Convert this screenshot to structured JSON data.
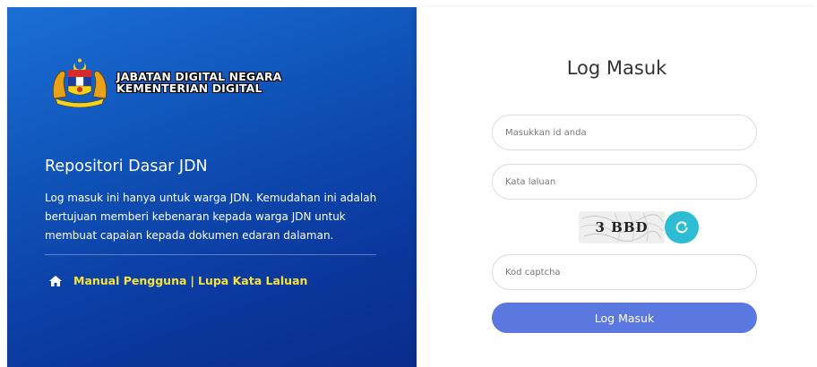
{
  "left": {
    "agency_line1": "JABATAN DIGITAL NEGARA",
    "agency_line2": "KEMENTERIAN DIGITAL",
    "title": "Repositori Dasar JDN",
    "description": "Log masuk ini hanya untuk warga JDN. Kemudahan ini adalah bertujuan memberi kebenaran kepada warga JDN untuk membuat capaian kepada dokumen edaran dalaman.",
    "links": {
      "manual": "Manual Pengguna",
      "separator": "|",
      "forgot": "Lupa Kata Laluan",
      "color": "#f7e23a"
    }
  },
  "form": {
    "title": "Log Masuk",
    "id_placeholder": "Masukkan id anda",
    "password_placeholder": "Kata laluan",
    "captcha_text": "3 BBD",
    "captcha_placeholder": "Kod captcha",
    "submit_label": "Log Masuk",
    "refresh_icon": "refresh-icon",
    "accent": "#5a78e0",
    "refresh_color": "#2cbcd3"
  },
  "colors": {
    "panel_top": "#1a6fd6",
    "panel_bottom": "#0a2c8c"
  }
}
